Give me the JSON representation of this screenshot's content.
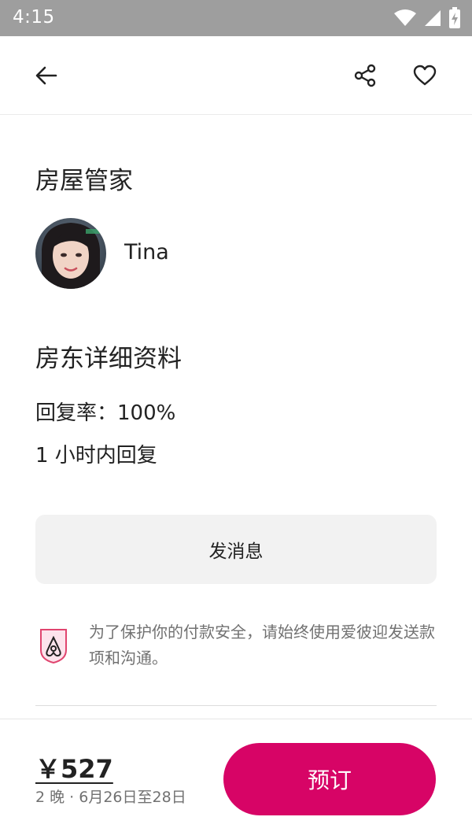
{
  "status_bar": {
    "time": "4:15"
  },
  "section_host": {
    "title": "房屋管家",
    "host_name": "Tina"
  },
  "section_details": {
    "title": "房东详细资料",
    "reply_rate": "回复率：100%",
    "reply_time": "1 小时内回复"
  },
  "message_button": {
    "label": "发消息"
  },
  "safety_notice": {
    "text": "为了保护你的付款安全，请始终使用爱彼迎发送款项和沟通。"
  },
  "footer": {
    "price": "￥527",
    "subtitle": "2 晚 · 6月26日至28日",
    "book_label": "预订"
  },
  "colors": {
    "accent": "#d70466",
    "status_bar": "#9e9e9e",
    "button_bg": "#f2f2f2"
  },
  "icons": [
    "back-arrow-icon",
    "share-icon",
    "heart-icon",
    "wifi-icon",
    "signal-icon",
    "battery-icon",
    "airbnb-shield-icon"
  ]
}
